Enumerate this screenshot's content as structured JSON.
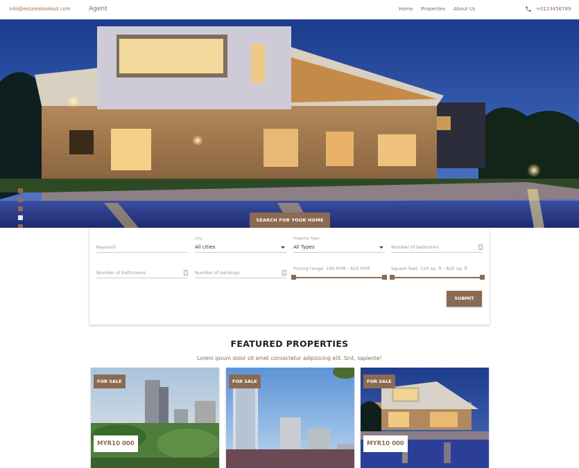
{
  "header": {
    "email": "info@estateslookout.com",
    "brand": "Agent",
    "nav": [
      "Home",
      "Properties",
      "About Us"
    ],
    "phone": "+0123456789"
  },
  "hero": {
    "slides": 6,
    "active_slide": 4,
    "search_tab_label": "SEARCH FOR YOUR HOME"
  },
  "search": {
    "keyword_placeholder": "Keyword",
    "city_label": "City",
    "city_value": "All cities",
    "type_label": "Property Type",
    "type_value": "All Types",
    "bedrooms_placeholder": "Number of bedrooms",
    "bathrooms_placeholder": "Number of bathrooms",
    "parkings_placeholder": "Number of parkings",
    "price_range_label": "Pricing range: 100 MYR - 820 MYR",
    "area_range_label": "Square feet: 120 sq. ft - 820 sq. ft",
    "submit_label": "SUBMIT"
  },
  "featured": {
    "title": "FEATURED PROPERTIES",
    "subtitle": "Lorem ipsum dolor sit amet consectetur adipisicing elit. Sint, sapiente!",
    "cards": [
      {
        "badge": "FOR SALE",
        "price": "MYR10 000"
      },
      {
        "badge": "FOR SALE",
        "price": ""
      },
      {
        "badge": "FOR SALE",
        "price": "MYR10 000"
      }
    ]
  },
  "colors": {
    "accent": "#8b6a52"
  },
  "icons": {
    "phone": "phone-icon"
  }
}
